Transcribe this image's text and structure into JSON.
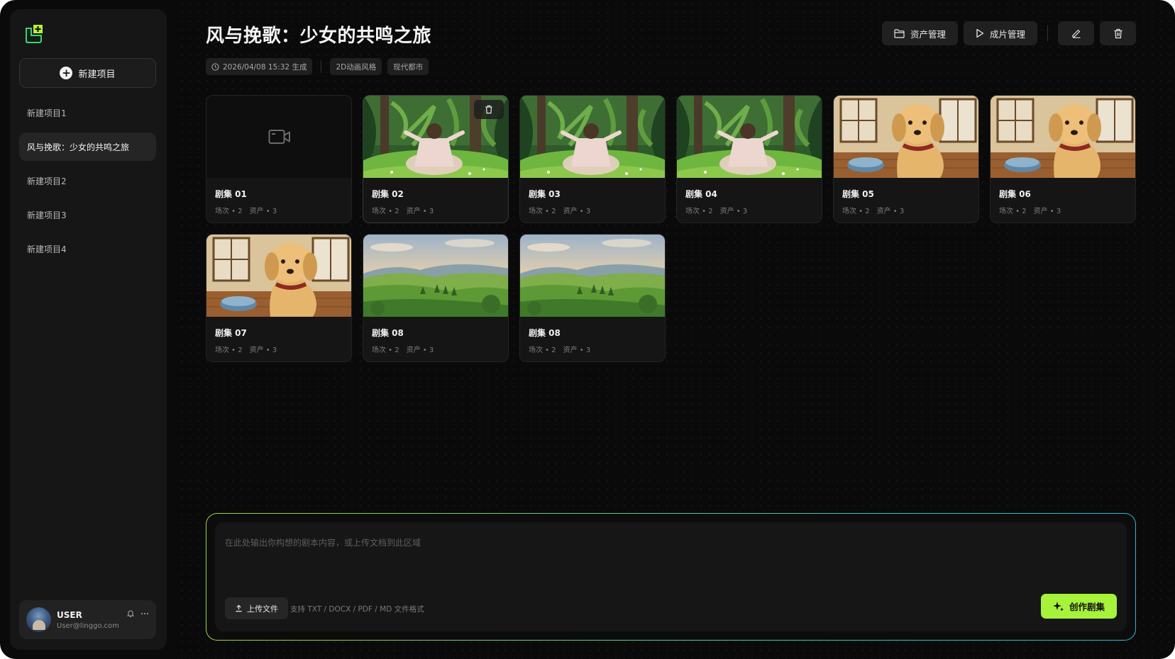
{
  "app": {
    "accent": "#a7f23a"
  },
  "sidebar": {
    "new_project_label": "新建项目",
    "projects": [
      {
        "label": "新建项目1",
        "active": false
      },
      {
        "label": "风与挽歌：少女的共鸣之旅",
        "active": true
      },
      {
        "label": "新建项目2",
        "active": false
      },
      {
        "label": "新建项目3",
        "active": false
      },
      {
        "label": "新建项目4",
        "active": false
      }
    ],
    "user": {
      "name": "USER",
      "email": "User@linggo.com"
    }
  },
  "header": {
    "title": "风与挽歌：少女的共鸣之旅",
    "generated_at": "2026/04/08 15:32 生成",
    "tags": [
      "2D动画风格",
      "现代都市"
    ],
    "actions": {
      "assets": "资产管理",
      "films": "成片管理"
    }
  },
  "episodes": [
    {
      "title": "剧集 01",
      "scenes": "场次 • 2",
      "assets": "资产 • 3",
      "thumb": "empty"
    },
    {
      "title": "剧集 02",
      "scenes": "场次 • 2",
      "assets": "资产 • 3",
      "thumb": "forest-girl"
    },
    {
      "title": "剧集 03",
      "scenes": "场次 • 2",
      "assets": "资产 • 3",
      "thumb": "forest-girl"
    },
    {
      "title": "剧集 04",
      "scenes": "场次 • 2",
      "assets": "资产 • 3",
      "thumb": "forest-girl"
    },
    {
      "title": "剧集 05",
      "scenes": "场次 • 2",
      "assets": "资产 • 3",
      "thumb": "dog-room"
    },
    {
      "title": "剧集 06",
      "scenes": "场次 • 2",
      "assets": "资产 • 3",
      "thumb": "dog-room"
    },
    {
      "title": "剧集 07",
      "scenes": "场次 • 2",
      "assets": "资产 • 3",
      "thumb": "dog-room"
    },
    {
      "title": "剧集 08",
      "scenes": "场次 • 2",
      "assets": "资产 • 3",
      "thumb": "hills"
    },
    {
      "title": "剧集 08",
      "scenes": "场次 • 2",
      "assets": "资产 • 3",
      "thumb": "hills"
    }
  ],
  "composer": {
    "placeholder": "在此处输出你构想的剧本内容，或上传文档到此区域",
    "upload_label": "上传文件",
    "upload_hint": "支持 TXT / DOCX / PDF / MD 文件格式",
    "create_label": "创作剧集"
  }
}
